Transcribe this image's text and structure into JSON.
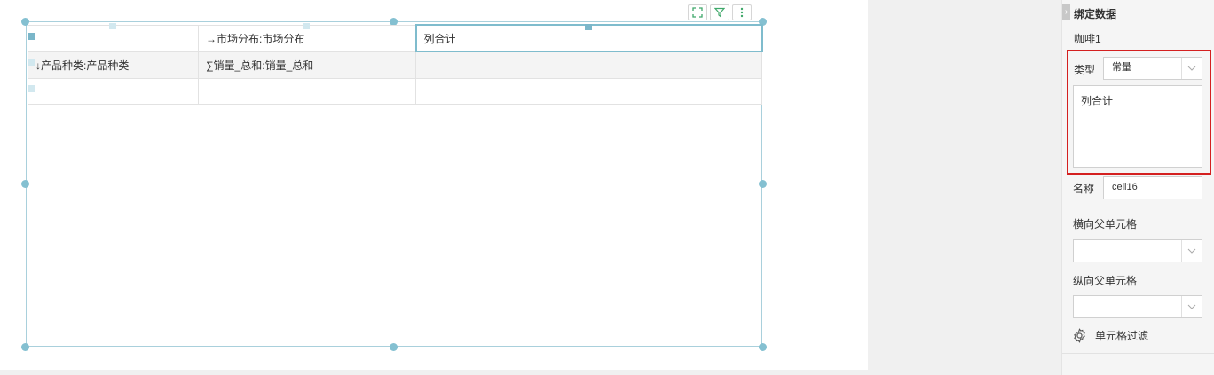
{
  "toolbar": {
    "icons": [
      "expand-icon",
      "filter-icon",
      "more-vertical-icon"
    ]
  },
  "table": {
    "rows": [
      [
        "",
        "→市场分布:市场分布",
        "列合计"
      ],
      [
        "↓产品种类:产品种类",
        "∑销量_总和:销量_总和",
        ""
      ],
      [
        "",
        "",
        ""
      ]
    ]
  },
  "panel": {
    "section_title": "绑定数据",
    "dataset": "咖啡1",
    "type_label": "类型",
    "type_value": "常量",
    "expression_value": "列合计",
    "name_label": "名称",
    "name_value": "cell16",
    "horizontal_parent_label": "横向父单元格",
    "horizontal_parent_value": "",
    "vertical_parent_label": "纵向父单元格",
    "vertical_parent_value": "",
    "cell_filter_label": "单元格过滤"
  },
  "colors": {
    "selection_border": "#a9d0dc",
    "handle": "#84c0d1",
    "highlight_box": "#d42020",
    "toolbar_icon": "#3fa86a"
  }
}
